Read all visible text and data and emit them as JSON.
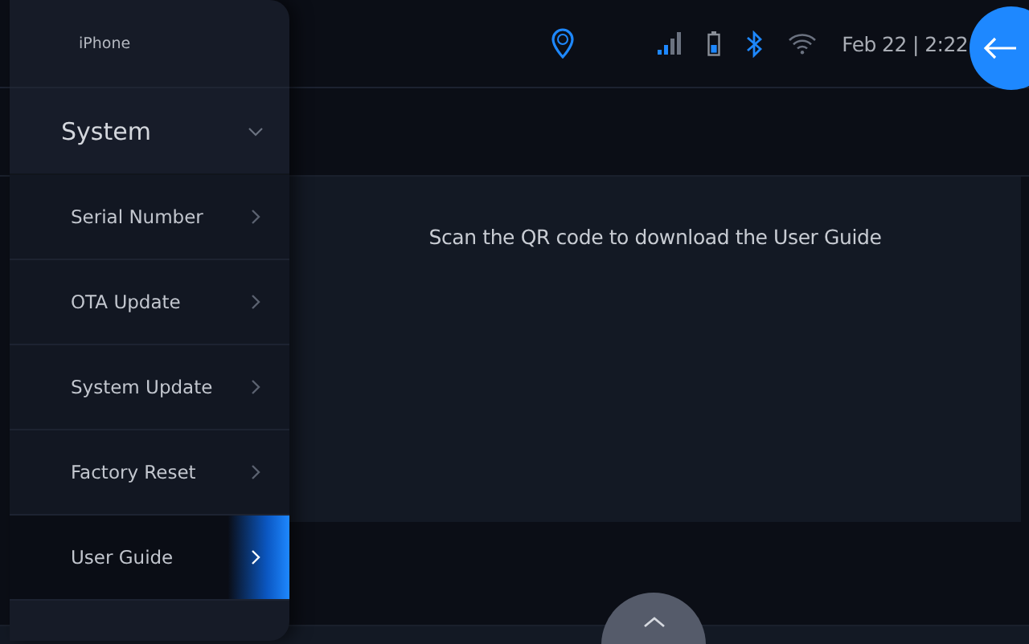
{
  "device": {
    "name": "iPhone"
  },
  "status_bar": {
    "datetime": "Feb 22 | 2:22",
    "bluetooth_on": true,
    "wifi_on": false
  },
  "sidebar": {
    "section": {
      "label": "System",
      "expanded": true
    },
    "items": [
      {
        "label": "Serial Number",
        "selected": false
      },
      {
        "label": "OTA Update",
        "selected": false
      },
      {
        "label": "System Update",
        "selected": false
      },
      {
        "label": "Factory Reset",
        "selected": false
      },
      {
        "label": "User Guide",
        "selected": true
      }
    ]
  },
  "content": {
    "message": "Scan the QR code to download the User Guide"
  }
}
